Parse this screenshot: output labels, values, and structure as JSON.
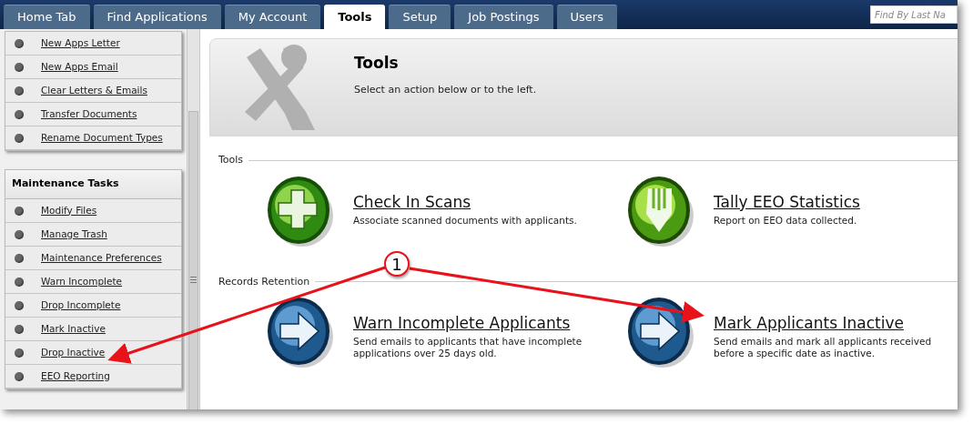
{
  "tabs": [
    {
      "label": "Home Tab",
      "selected": false
    },
    {
      "label": "Find Applications",
      "selected": false
    },
    {
      "label": "My Account",
      "selected": false
    },
    {
      "label": "Tools",
      "selected": true
    },
    {
      "label": "Setup",
      "selected": false
    },
    {
      "label": "Job Postings",
      "selected": false
    },
    {
      "label": "Users",
      "selected": false
    }
  ],
  "search": {
    "placeholder": "Find By Last Na"
  },
  "sidebar": {
    "sections": [
      {
        "items": [
          "New Apps Letter",
          "New Apps Email",
          "Clear Letters & Emails",
          "Transfer Documents",
          "Rename Document Types"
        ]
      },
      {
        "title": "Maintenance Tasks",
        "items": [
          "Modify Files",
          "Manage Trash",
          "Maintenance Preferences",
          "Warn Incomplete",
          "Drop Incomplete",
          "Mark Inactive",
          "Drop Inactive",
          "EEO Reporting"
        ]
      }
    ]
  },
  "header": {
    "title": "Tools",
    "subtitle": "Select an action below or to the left."
  },
  "sections": [
    {
      "title": "Tools",
      "actions": [
        {
          "kind": "plus",
          "title": "Check In Scans",
          "description": "Associate scanned documents with applicants."
        },
        {
          "kind": "pencil",
          "title": "Tally EEO Statistics",
          "description": "Report on EEO data collected."
        }
      ]
    },
    {
      "title": "Records Retention",
      "actions": [
        {
          "kind": "arrow",
          "title": "Warn Incomplete Applicants",
          "description": "Send emails to applicants that have incomplete applications over 25 days old."
        },
        {
          "kind": "arrow",
          "title": "Mark Applicants Inactive",
          "description": "Send emails and mark all applicants received before a specific date as inactive."
        }
      ]
    }
  ],
  "annotation": {
    "label": "1"
  }
}
